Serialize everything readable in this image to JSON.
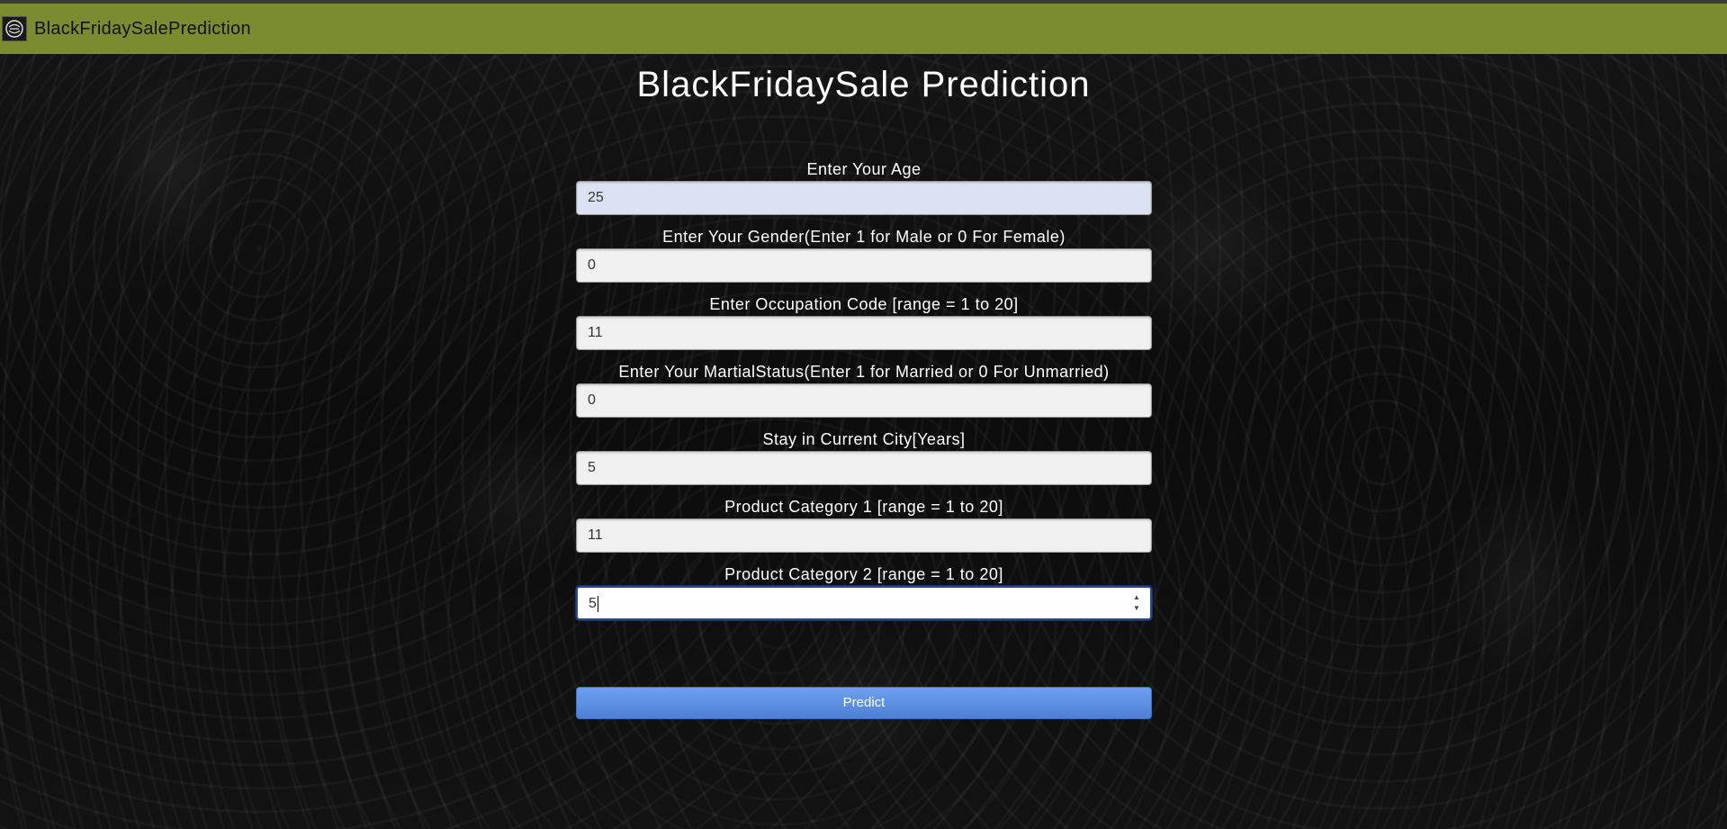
{
  "navbar": {
    "brand": "BlackFridaySalePrediction",
    "logo_icon": "brand-logo-icon"
  },
  "page": {
    "title": "BlackFridaySale Prediction"
  },
  "form": {
    "fields": [
      {
        "label": "Enter Your Age",
        "value": "25"
      },
      {
        "label": "Enter Your Gender(Enter 1 for Male or 0 For Female)",
        "value": "0"
      },
      {
        "label": "Enter Occupation Code [range = 1 to 20]",
        "value": "11"
      },
      {
        "label": "Enter Your MartialStatus(Enter 1 for Married or 0 For Unmarried)",
        "value": "0"
      },
      {
        "label": "Stay in Current City[Years]",
        "value": "5"
      },
      {
        "label": "Product Category 1 [range = 1 to 20]",
        "value": "11"
      },
      {
        "label": "Product Category 2 [range = 1 to 20]",
        "value": "5"
      }
    ],
    "submit_label": "Predict"
  },
  "colors": {
    "navbar": "#7a8c30",
    "button": "#5b8de0",
    "focus_border": "#2a4a8a"
  }
}
